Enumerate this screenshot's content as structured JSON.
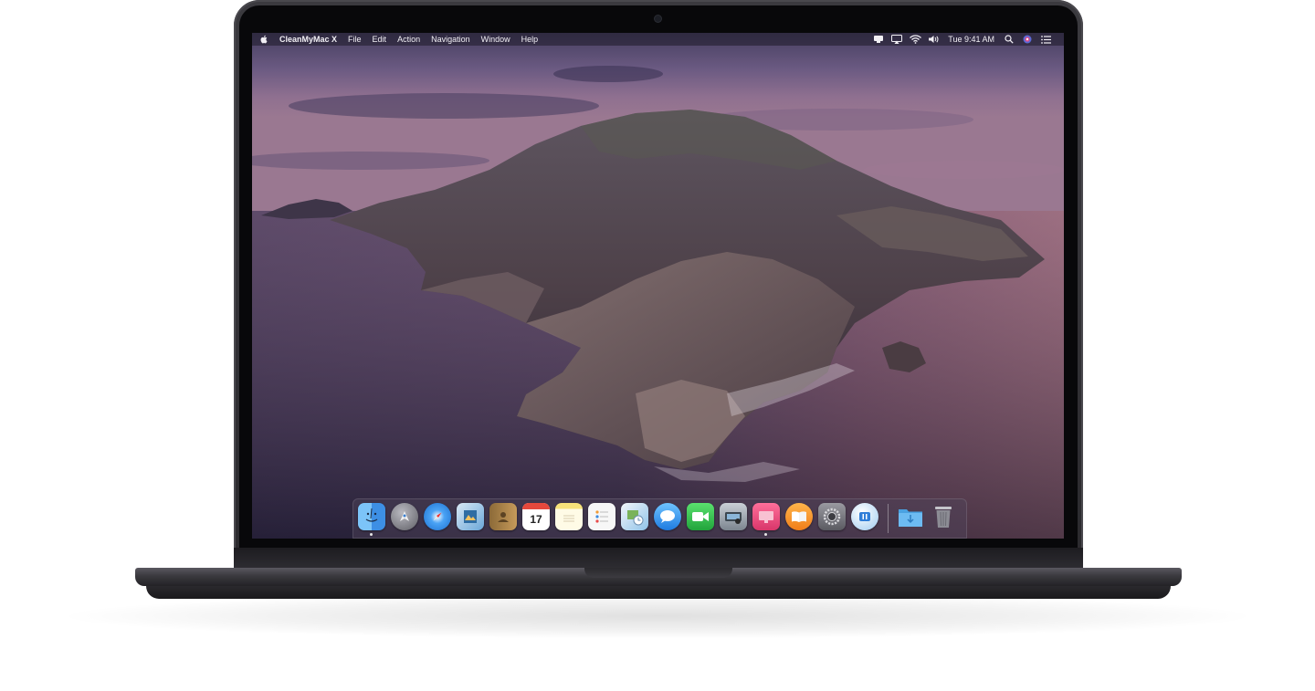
{
  "menubar": {
    "apple_icon": "apple-logo-icon",
    "app_name": "CleanMyMac X",
    "menus": [
      "File",
      "Edit",
      "Action",
      "Navigation",
      "Window",
      "Help"
    ],
    "status_icons": [
      "cleanmymac-menu-icon",
      "airplay-icon",
      "wifi-icon",
      "volume-icon"
    ],
    "clock": "Tue 9:41 AM",
    "right_icons": [
      "spotlight-search-icon",
      "siri-icon",
      "notification-center-icon"
    ]
  },
  "dock": {
    "calendar_date": "17",
    "apps": [
      {
        "name": "finder-icon",
        "color": "#4ea3f0",
        "running": true
      },
      {
        "name": "launchpad-icon",
        "color": "#8f8f96",
        "running": false
      },
      {
        "name": "safari-icon",
        "color": "#3a8ee6",
        "running": false
      },
      {
        "name": "preview-icon",
        "color": "#6aa6d8",
        "running": false
      },
      {
        "name": "contacts-icon",
        "color": "#b08a4e",
        "running": false
      },
      {
        "name": "calendar-icon",
        "color": "#ffffff",
        "running": false
      },
      {
        "name": "notes-icon",
        "color": "#f7e27a",
        "running": false
      },
      {
        "name": "reminders-icon",
        "color": "#f4f4f4",
        "running": false
      },
      {
        "name": "photos-preview-icon",
        "color": "#8fc2e8",
        "running": false
      },
      {
        "name": "messages-icon",
        "color": "#4aa8f5",
        "running": false
      },
      {
        "name": "facetime-icon",
        "color": "#3cc85a",
        "running": false
      },
      {
        "name": "image-capture-icon",
        "color": "#9aa3ad",
        "running": false
      },
      {
        "name": "cleanmymac-icon",
        "color": "#e8507e",
        "running": true
      },
      {
        "name": "books-icon",
        "color": "#f39a2a",
        "running": false
      },
      {
        "name": "system-preferences-icon",
        "color": "#8a8a90",
        "running": false
      },
      {
        "name": "translator-icon",
        "color": "#cfe4f7",
        "running": false
      }
    ],
    "folders": [
      {
        "name": "downloads-folder-icon",
        "color": "#5cb4ef"
      },
      {
        "name": "trash-icon",
        "color": "#9c9ca3"
      }
    ]
  },
  "colors": {
    "menubar_text": "#f2f0f5",
    "laptop_body": "#3b3a3f",
    "bezel": "#08080a"
  }
}
